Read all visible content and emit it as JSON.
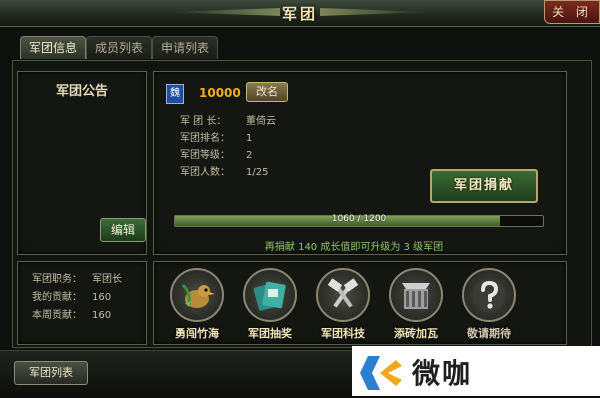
{
  "window": {
    "title": "军团",
    "close_label": "关 闭"
  },
  "tabs": [
    {
      "label": "军团信息",
      "active": true
    },
    {
      "label": "成员列表",
      "active": false
    },
    {
      "label": "申请列表",
      "active": false
    }
  ],
  "notice": {
    "title": "军团公告",
    "edit_label": "编辑"
  },
  "info": {
    "badge": "魏",
    "points": "10000",
    "rename_label": "改名",
    "rows": [
      {
        "label": "军 团 长：",
        "value": "董倚云"
      },
      {
        "label": "军团排名：",
        "value": "1"
      },
      {
        "label": "军团等级：",
        "value": "2"
      },
      {
        "label": "军团人数：",
        "value": "1/25"
      }
    ],
    "donate_label": "军团捐献",
    "progress": {
      "text": "1060 / 1200",
      "current": 1060,
      "max": 1200
    },
    "upgrade_msg": "再捐献 140 成长值即可升级为 3 级军团"
  },
  "member": {
    "rows": [
      {
        "label": "军团职务：",
        "value": "军团长"
      },
      {
        "label": "我的贡献：",
        "value": "160"
      },
      {
        "label": "本周贡献：",
        "value": "160"
      }
    ]
  },
  "features": [
    {
      "label": "勇闯竹海",
      "icon": "bird-icon"
    },
    {
      "label": "军团抽奖",
      "icon": "cards-icon"
    },
    {
      "label": "军团科技",
      "icon": "tools-icon"
    },
    {
      "label": "添砖加瓦",
      "icon": "wall-icon"
    },
    {
      "label": "敬请期待",
      "icon": "question-icon"
    }
  ],
  "footer": {
    "list_label": "军团列表"
  },
  "watermark": {
    "text": "微咖"
  },
  "colors": {
    "accent_gold": "#f0b020",
    "progress_green": "#7fa05a",
    "message_green": "#8ec36a"
  }
}
